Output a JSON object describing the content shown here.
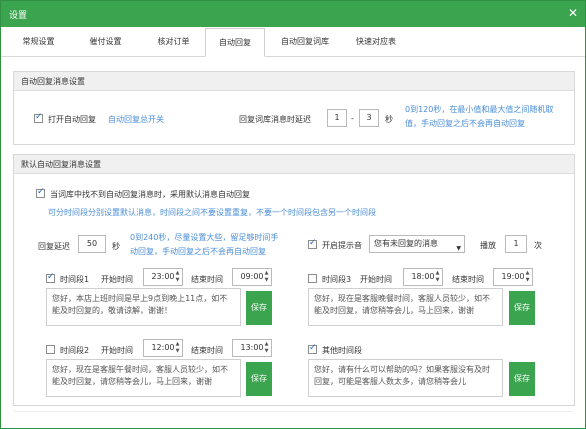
{
  "window": {
    "title": "设置",
    "close": "✕"
  },
  "tabs": [
    {
      "label": "常规设置"
    },
    {
      "label": "催付设置"
    },
    {
      "label": "核对订单"
    },
    {
      "label": "自动回复"
    },
    {
      "label": "自动回复词库"
    },
    {
      "label": "快速对应表"
    }
  ],
  "auto_reply_settings": {
    "section_title": "自动回复消息设置",
    "enable_label": "打开自动回复",
    "enable_hint": "自动回复总开关",
    "delay_label": "回复词库消息时延迟",
    "delay_min": "1",
    "delay_dash": "-",
    "delay_max": "3",
    "delay_unit": "秒",
    "delay_help_line1": "0到120秒，在最小值和最大值之间随机取",
    "delay_help_line2": "值，手动回复之后不会再自动回复"
  },
  "default_settings": {
    "section_title": "默认自动回复消息设置",
    "fallback_label": "当词库中找不到自动回复消息时，采用默认消息自动回复",
    "fallback_hint": "可分时间段分别设置默认消息，时间段之间不要设置重复，不要一个时间段包含另一个时间段",
    "reply_delay_label": "回复延迟",
    "reply_delay_value": "50",
    "reply_delay_unit": "秒",
    "reply_delay_help_line1": "0到240秒，尽量设置大些，留足够时间手",
    "reply_delay_help_line2": "动回复，手动回复之后不会再自动回复",
    "tone_label": "开启提示音",
    "tone_value": "您有未回复的消息",
    "play_label": "播放",
    "play_times": "1",
    "play_unit": "次",
    "save_label": "保存",
    "start_label": "开始时间",
    "end_label": "结束时间",
    "periods": [
      {
        "name": "时间段1",
        "start": "23:00",
        "end": "09:00",
        "message": "您好，本店上班时间是早上9点到晚上11点，如不能及时回复的，敬请谅解，谢谢！"
      },
      {
        "name": "时间段3",
        "start": "18:00",
        "end": "19:00",
        "message": "您好，现在是客服晚餐时间，客服人员较少，如不能及时回复，请您稍等会儿，马上回来，谢谢"
      },
      {
        "name": "时间段2",
        "start": "12:00",
        "end": "13:00",
        "message": "您好，现在是客服午餐时间，客服人员较少，如不能及时回复，请您稍等会儿，马上回来，谢谢"
      },
      {
        "name": "其他时间段",
        "message": "您好，请有什么可以帮助的吗？如果客服没有及时回复，可能是客服人数太多，请您稍等会儿"
      }
    ]
  },
  "colors": {
    "accent": "#3aa44f",
    "hint": "#4a8ed8",
    "section_bg": "#f0f0f0"
  }
}
